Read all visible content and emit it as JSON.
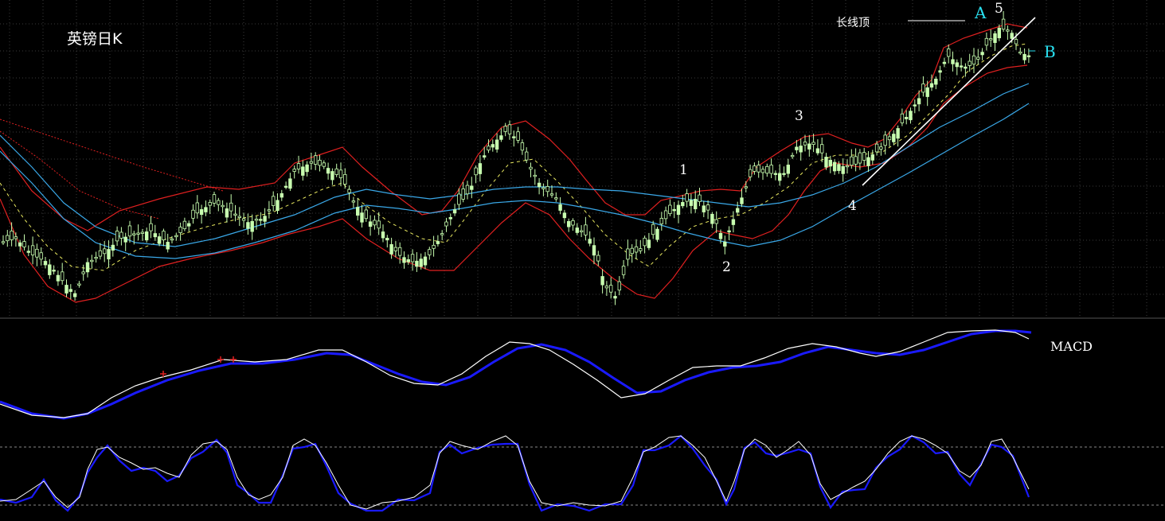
{
  "chart_data": {
    "type": "candlestick",
    "title": "英镑日K",
    "panels": [
      "price",
      "MACD",
      "stochastic"
    ],
    "annotations": {
      "wave_1": "1",
      "wave_2": "2",
      "wave_3": "3",
      "wave_4": "4",
      "wave_5": "5",
      "point_a": "A",
      "point_b": "B",
      "long_top": "长线顶"
    },
    "macd_label": "MACD",
    "colors": {
      "background": "#000000",
      "candle": "#c8ffb0",
      "bollinger_band": "#e02020",
      "moving_average": "#3aa8e8",
      "middle_line": "#e8e860",
      "macd_line": "#ffffff",
      "signal_line": "#1a1aff",
      "annotation_cyan": "#29e0f0",
      "grid": "#3a3a3a"
    },
    "grid": true
  }
}
